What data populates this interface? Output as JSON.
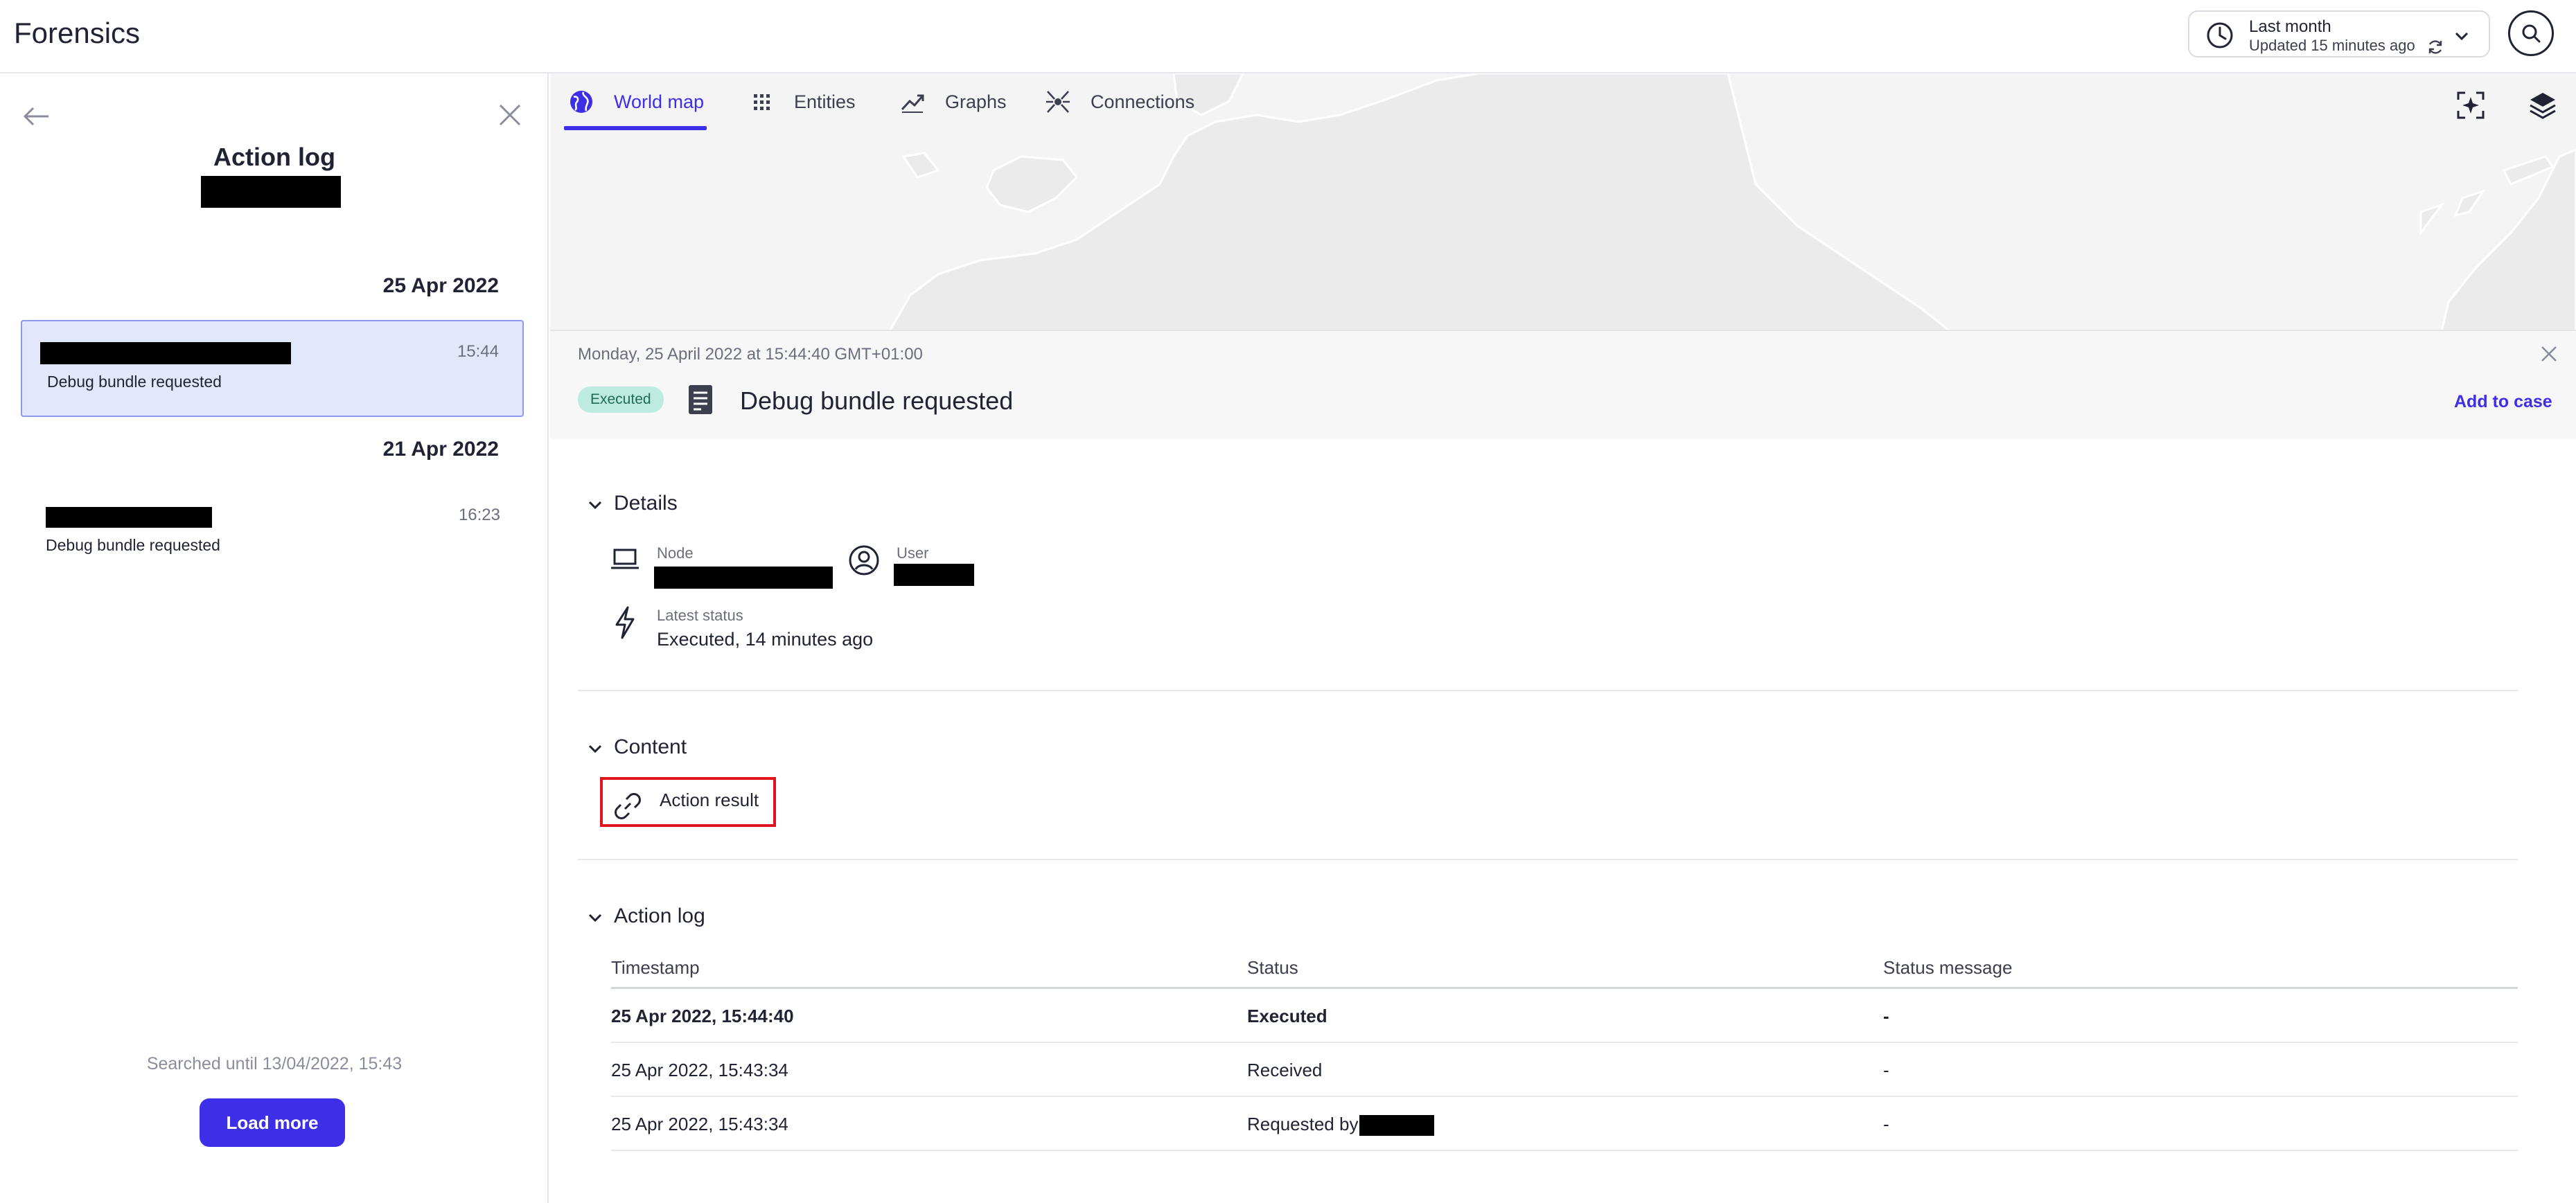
{
  "app": {
    "title": "Forensics"
  },
  "time_picker": {
    "label": "Last month",
    "updated": "Updated 15 minutes ago"
  },
  "left_panel": {
    "title": "Action log",
    "groups": [
      {
        "date": "25 Apr 2022",
        "items": [
          {
            "time": "15:44",
            "text": "Debug bundle requested",
            "selected": true
          }
        ]
      },
      {
        "date": "21 Apr 2022",
        "items": [
          {
            "time": "16:23",
            "text": "Debug bundle requested",
            "selected": false
          }
        ]
      }
    ],
    "searched_until": "Searched until 13/04/2022, 15:43",
    "load_more_label": "Load more"
  },
  "tabs": [
    {
      "label": "World map",
      "icon": "globe-icon",
      "active": true
    },
    {
      "label": "Entities",
      "icon": "grid-icon",
      "active": false
    },
    {
      "label": "Graphs",
      "icon": "trend-icon",
      "active": false
    },
    {
      "label": "Connections",
      "icon": "connections-icon",
      "active": false
    }
  ],
  "detail": {
    "datetime": "Monday, 25 April 2022 at 15:44:40 GMT+01:00",
    "status_badge": "Executed",
    "title": "Debug bundle requested",
    "add_to_case": "Add to case",
    "details_section": {
      "heading": "Details",
      "node_label": "Node",
      "user_label": "User",
      "latest_status_label": "Latest status",
      "latest_status_value": "Executed, 14 minutes ago"
    },
    "content_section": {
      "heading": "Content",
      "action_result_label": "Action result"
    },
    "action_log_section": {
      "heading": "Action log",
      "columns": [
        "Timestamp",
        "Status",
        "Status message"
      ],
      "rows": [
        {
          "timestamp": "25 Apr 2022, 15:44:40",
          "status": "Executed",
          "message": "-"
        },
        {
          "timestamp": "25 Apr 2022, 15:43:34",
          "status": "Received",
          "message": "-"
        },
        {
          "timestamp": "25 Apr 2022, 15:43:34",
          "status": "Requested by",
          "message": "-"
        }
      ]
    }
  },
  "colors": {
    "accent": "#3d2ee8",
    "badge_bg": "#bdebdf",
    "selected_bg": "#e3e7fb",
    "highlight": "#e0141e"
  }
}
